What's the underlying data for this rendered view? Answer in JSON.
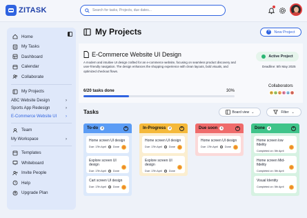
{
  "app": {
    "name": "ZITASK"
  },
  "search": {
    "placeholder": "Search for tasks, Projects, due dates..."
  },
  "sidebar": {
    "top_items": [
      {
        "label": "Home",
        "icon": "home-icon"
      },
      {
        "label": "My Tasks",
        "icon": "tasks-icon"
      },
      {
        "label": "Dashboard",
        "icon": "dashboard-icon"
      },
      {
        "label": "Calendar",
        "icon": "calendar-icon"
      },
      {
        "label": "Collaborate",
        "icon": "collaborate-icon"
      }
    ],
    "projects_label": "My Projects",
    "projects": [
      {
        "label": "ABC Website Design"
      },
      {
        "label": "Sports App Redesign"
      },
      {
        "label": "E-Commerce Website UI"
      }
    ],
    "team_label": "Team",
    "workspace_label": "My Workspace",
    "bottom_items": [
      {
        "label": "Templates",
        "icon": "templates-icon"
      },
      {
        "label": "Whiteboard",
        "icon": "whiteboard-icon"
      },
      {
        "label": "Invite People",
        "icon": "invite-icon"
      },
      {
        "label": "Help",
        "icon": "help-icon"
      },
      {
        "label": "Upgrade Plan",
        "icon": "upgrade-icon"
      }
    ]
  },
  "main": {
    "title": "My Projects",
    "new_project_label": "New Project"
  },
  "project": {
    "title": "E-Commerce Website UI Design",
    "description": "A modern and intuitive UI design crafted for an e-commerce website, focusing on seamless product discovery and user-friendly navigation. The design enhances the shopping experience with clean layouts, bold visuals, and optimized checkout flows.",
    "status": "Active Project",
    "deadline": "Deadline: 5th May 2025",
    "progress_label": "6/20 tasks done",
    "progress_percent_label": "30%",
    "progress_fraction": 0.3,
    "collaborators_label": "Collaborators",
    "collaborators": [
      {
        "initial": "R",
        "color": "#f5c24c"
      },
      {
        "initial": "N",
        "color": "#b5e07a"
      },
      {
        "initial": "L",
        "color": "#f5a35c"
      },
      {
        "initial": "K",
        "color": "#f08ab0"
      },
      {
        "initial": "A",
        "color": "#9ed3f5"
      },
      {
        "initial": "S",
        "color": "#f07a6a"
      }
    ]
  },
  "tasks": {
    "title": "Tasks",
    "board_view_label": "Board view",
    "filter_label": "Filter",
    "columns": [
      {
        "title": "To-do",
        "count": "3",
        "head_color": "#5b9cf5",
        "body_color": "#dce9fb",
        "cards": [
          {
            "title": "Home screen UI design",
            "date": "Due: 17th April",
            "status": "Done"
          },
          {
            "title": "Explore screen UI design",
            "date": "Due: 17th April",
            "status": "Done"
          },
          {
            "title": "Cart screen UI design",
            "date": "Due: 17th April",
            "status": "Done"
          }
        ]
      },
      {
        "title": "In-Progress",
        "count": "2",
        "head_color": "#f5b93a",
        "body_color": "#fbeed0",
        "cards": [
          {
            "title": "Home screen UI design",
            "date": "Due: 17th April",
            "status": "Done"
          },
          {
            "title": "Explore screen UI design",
            "date": "Due: 17th April",
            "status": "Done"
          }
        ]
      },
      {
        "title": "Due soon",
        "count": "1",
        "head_color": "#ef6b6b",
        "body_color": "#fbd9d9",
        "cards": [
          {
            "title": "Home screen UI design",
            "date": "Due: 17th April",
            "status": "Done"
          }
        ]
      },
      {
        "title": "Done",
        "count": "4",
        "head_color": "#3fc48a",
        "body_color": "#d6f2e2",
        "cards": [
          {
            "title": "Home screen low fidelity",
            "date": "Completed on: 5th April",
            "status": ""
          },
          {
            "title": "Home screen Mid-fidelity",
            "date": "Completed on: 5th April",
            "status": ""
          },
          {
            "title": "Visual Identity",
            "date": "Completed on: 5th April",
            "status": ""
          }
        ]
      }
    ]
  }
}
